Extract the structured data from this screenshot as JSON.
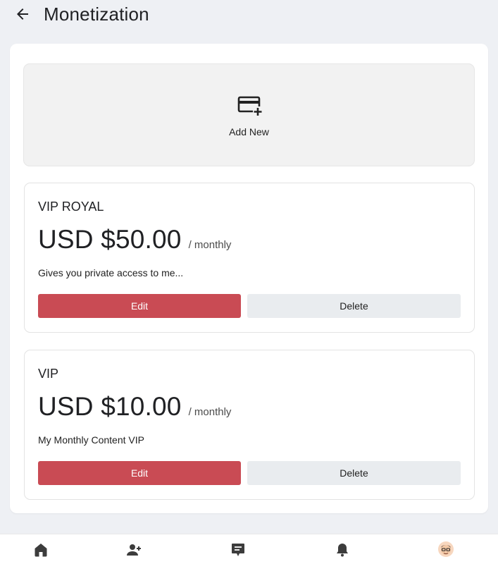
{
  "header": {
    "title": "Monetization",
    "back_icon": "arrow-left-icon"
  },
  "add_new": {
    "label": "Add New",
    "icon": "credit-card-plus-icon"
  },
  "plans": [
    {
      "name": "VIP ROYAL",
      "price": "USD $50.00",
      "period": "/ monthly",
      "description": "Gives you private access to me...",
      "edit_label": "Edit",
      "delete_label": "Delete"
    },
    {
      "name": "VIP",
      "price": "USD $10.00",
      "period": "/ monthly",
      "description": "My Monthly Content VIP",
      "edit_label": "Edit",
      "delete_label": "Delete"
    }
  ],
  "bottom_nav": {
    "items": [
      {
        "icon": "home-icon"
      },
      {
        "icon": "add-user-icon"
      },
      {
        "icon": "messages-icon"
      },
      {
        "icon": "notifications-bell-icon"
      },
      {
        "icon": "profile-avatar-icon"
      }
    ]
  },
  "colors": {
    "accent": "#c94b54",
    "background": "#eef0f4",
    "secondary_button": "#e9ecef"
  }
}
